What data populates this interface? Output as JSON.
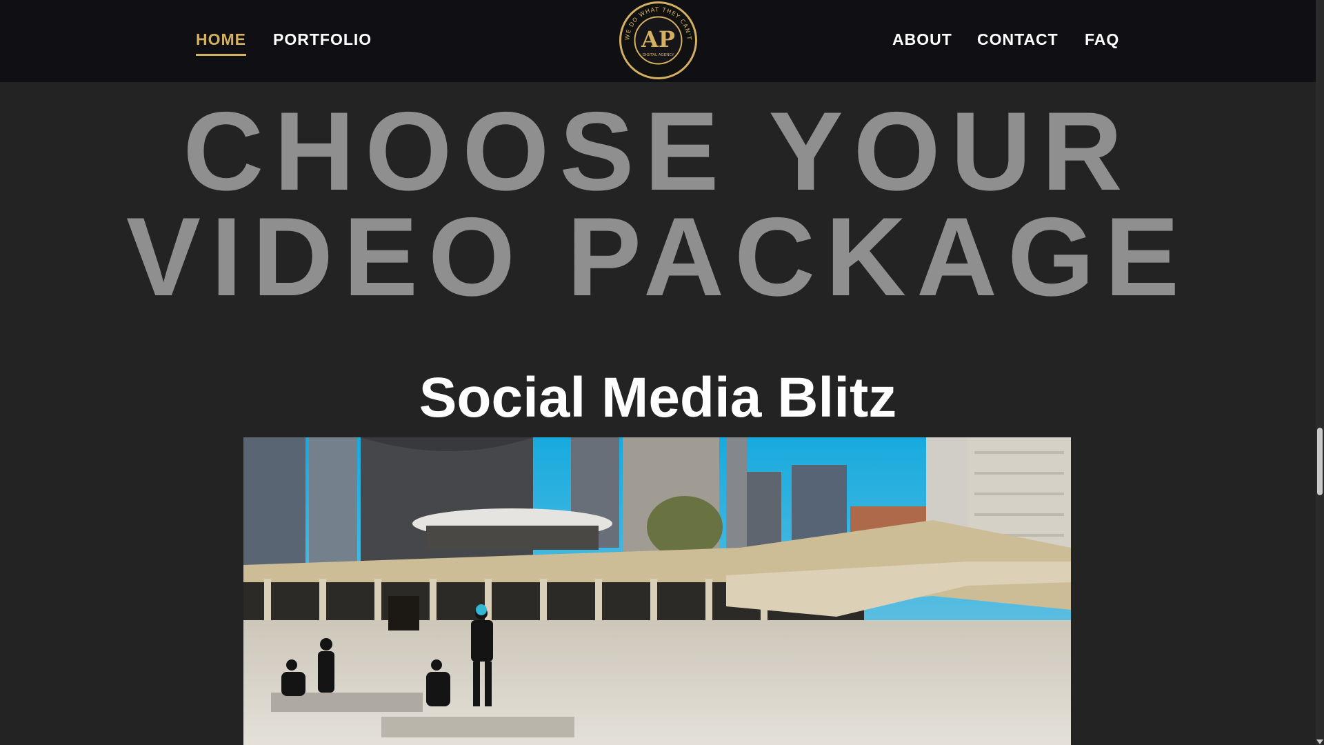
{
  "nav": {
    "left": [
      {
        "label": "HOME",
        "active": true
      },
      {
        "label": "PORTFOLIO",
        "active": false
      }
    ],
    "right": [
      {
        "label": "ABOUT"
      },
      {
        "label": "CONTACT"
      },
      {
        "label": "FAQ"
      }
    ],
    "logo": {
      "monogram": "AP",
      "ring_text": "WE DO WHAT THEY CAN'T",
      "sub_text": "DIGITAL AGENCY",
      "accent_color": "#d4b061"
    }
  },
  "hero": {
    "line1": "CHOOSE YOUR",
    "line2": "VIDEO PACKAGE"
  },
  "package": {
    "title": "Social Media Blitz"
  },
  "colors": {
    "background": "#232323",
    "navbar": "#0f0f14",
    "accent": "#d4b061",
    "hero_text": "#8f8f8f"
  }
}
